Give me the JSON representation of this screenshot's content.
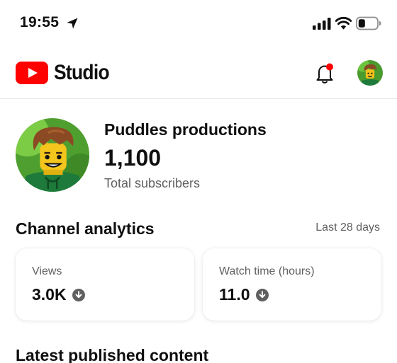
{
  "status_bar": {
    "time": "19:55",
    "icons": [
      "location-arrow-icon",
      "cellular-signal-icon",
      "wifi-icon",
      "battery-icon"
    ]
  },
  "header": {
    "logo_text": "Studio",
    "brand_color": "#ff0000",
    "notification_badge_color": "#ff0000",
    "icons": [
      "youtube-logo-icon",
      "bell-icon"
    ]
  },
  "channel": {
    "name": "Puddles productions",
    "subscriber_count": "1,100",
    "subscriber_label": "Total subscribers"
  },
  "analytics": {
    "title": "Channel analytics",
    "range": "Last 28 days",
    "cards": [
      {
        "label": "Views",
        "value": "3.0K",
        "trend": "down"
      },
      {
        "label": "Watch time (hours)",
        "value": "11.0",
        "trend": "down"
      }
    ]
  },
  "latest": {
    "title": "Latest published content"
  }
}
